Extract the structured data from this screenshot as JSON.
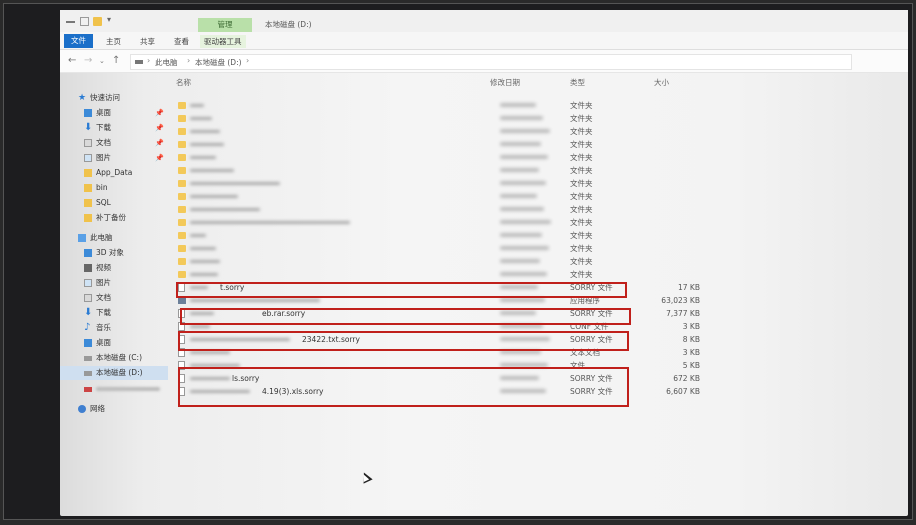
{
  "window": {
    "title": "本地磁盘 (D:)",
    "manage_tab": "管理"
  },
  "ribbon": {
    "tabs": [
      "文件",
      "主页",
      "共享",
      "查看",
      "驱动器工具"
    ]
  },
  "address": {
    "crumbs": [
      "此电脑",
      "本地磁盘 (D:)"
    ]
  },
  "columns": {
    "name": "名称",
    "date": "修改日期",
    "type": "类型",
    "size": "大小"
  },
  "nav": {
    "quick_access": "快速访问",
    "quick_items": [
      "桌面",
      "下载",
      "文档",
      "图片",
      "App_Data",
      "bin",
      "SQL",
      "补丁备份"
    ],
    "this_pc": "此电脑",
    "pc_items": [
      "3D 对象",
      "视频",
      "图片",
      "文档",
      "下载",
      "音乐",
      "桌面",
      "本地磁盘 (C:)",
      "本地磁盘 (D:)"
    ],
    "network": "网络"
  },
  "files": [
    {
      "icon": "folder",
      "name": "",
      "type": "文件夹",
      "size": ""
    },
    {
      "icon": "folder",
      "name": "",
      "type": "文件夹",
      "size": ""
    },
    {
      "icon": "folder",
      "name": "",
      "type": "文件夹",
      "size": ""
    },
    {
      "icon": "folder",
      "name": "",
      "type": "文件夹",
      "size": ""
    },
    {
      "icon": "folder",
      "name": "",
      "type": "文件夹",
      "size": ""
    },
    {
      "icon": "folder",
      "name": "",
      "type": "文件夹",
      "size": ""
    },
    {
      "icon": "folder",
      "name": "",
      "type": "文件夹",
      "size": ""
    },
    {
      "icon": "folder",
      "name": "",
      "type": "文件夹",
      "size": ""
    },
    {
      "icon": "folder",
      "name": "",
      "type": "文件夹",
      "size": ""
    },
    {
      "icon": "folder",
      "name": "",
      "type": "文件夹",
      "size": ""
    },
    {
      "icon": "folder",
      "name": "",
      "type": "文件夹",
      "size": ""
    },
    {
      "icon": "folder",
      "name": "",
      "type": "文件夹",
      "size": ""
    },
    {
      "icon": "folder",
      "name": "",
      "type": "文件夹",
      "size": ""
    },
    {
      "icon": "folder",
      "name": "",
      "type": "文件夹",
      "size": ""
    },
    {
      "icon": "doc",
      "name": "t.sorry",
      "type": "SORRY 文件",
      "size": "17 KB"
    },
    {
      "icon": "app",
      "name": "",
      "type": "应用程序",
      "size": "63,023 KB"
    },
    {
      "icon": "doc",
      "name": "eb.rar.sorry",
      "type": "SORRY 文件",
      "size": "7,377 KB"
    },
    {
      "icon": "doc",
      "name": "",
      "type": "CONF 文件",
      "size": "3 KB"
    },
    {
      "icon": "doc",
      "name": "23422.txt.sorry",
      "type": "SORRY 文件",
      "size": "8 KB"
    },
    {
      "icon": "doc",
      "name": "",
      "type": "文本文档",
      "size": "3 KB"
    },
    {
      "icon": "doc",
      "name": "",
      "type": "文件",
      "size": "5 KB"
    },
    {
      "icon": "doc",
      "name": "ls.sorry",
      "type": "SORRY 文件",
      "size": "672 KB"
    },
    {
      "icon": "doc",
      "name": "4.19(3).xls.sorry",
      "type": "SORRY 文件",
      "size": "6,607 KB"
    }
  ],
  "colors": {
    "highlight_box": "#c0201b",
    "file_tab": "#1a6fc9",
    "manage_tab": "#b9e0a9",
    "folder": "#f3c95a"
  }
}
